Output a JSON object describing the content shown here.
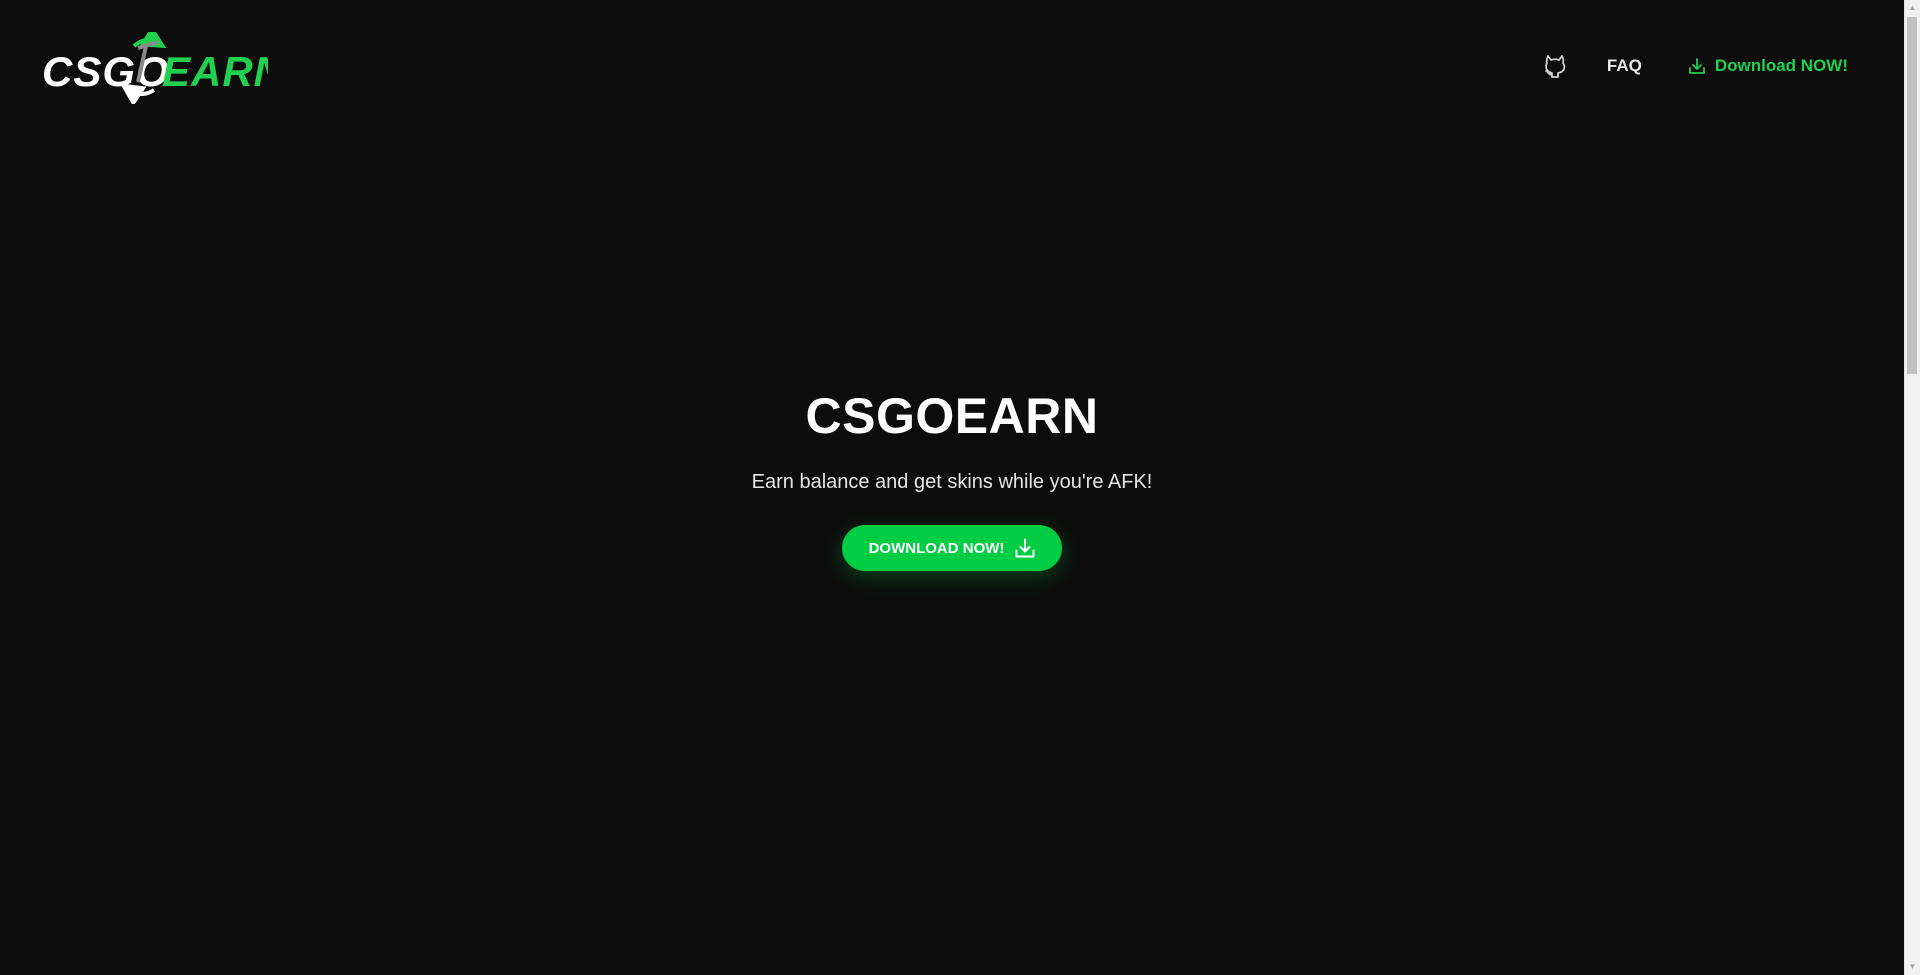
{
  "header": {
    "logo": {
      "text_left": "CSGO",
      "text_right": "EARN",
      "icon": "pickaxe-recycle-icon"
    },
    "nav": {
      "github_icon": "github-icon",
      "faq_label": "FAQ",
      "download_label": "Download NOW!",
      "download_icon": "download-icon"
    }
  },
  "hero": {
    "title": "CSGOEARN",
    "subtitle": "Earn balance and get skins while you're AFK!",
    "button_label": "DOWNLOAD NOW!",
    "button_icon": "download-icon"
  },
  "colors": {
    "background": "#0d0d0d",
    "accent": "#00cc44",
    "accent_text": "#21d04f",
    "text": "#ffffff"
  },
  "scrollbar": {
    "up_glyph": "▲",
    "down_glyph": "▼"
  }
}
